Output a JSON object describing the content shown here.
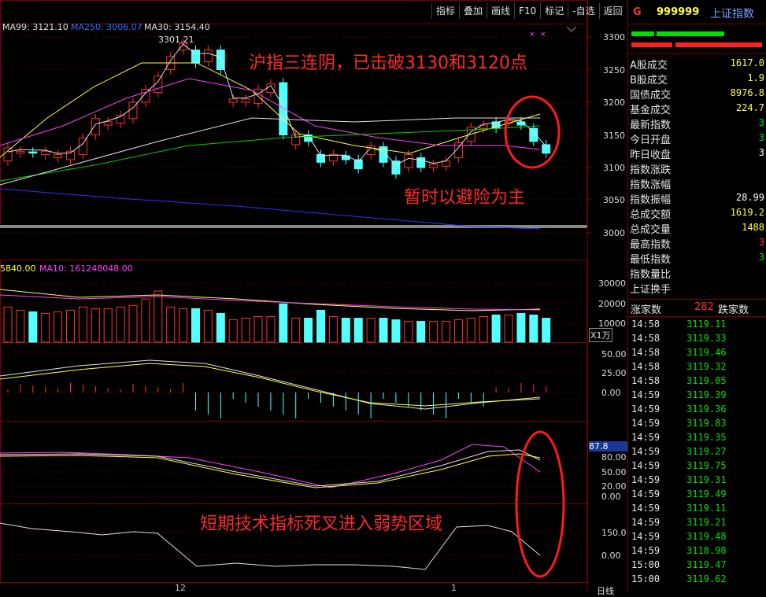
{
  "toolbar": {
    "items": [
      "指标",
      "叠加",
      "画线",
      "F10",
      "标记",
      "-自选",
      "返回"
    ]
  },
  "header": {
    "ma99_label": "MA99: 3121.10",
    "ma250_label": "MA250: 3006.07",
    "ma30_label": "MA30: 3154.40",
    "high_marker": "3301.21",
    "vol_label": "5840.00",
    "vol_ma10_label": "MA10: 161248048.00",
    "vol_unit": "X1万",
    "day_marker": "12",
    "day_marker2": "1",
    "bottom_tab": "日线"
  },
  "price_axis": [
    "3300",
    "3250",
    "3200",
    "3150",
    "3100",
    "3050",
    "3000"
  ],
  "vol_axis": [
    "30000",
    "20000",
    "10000"
  ],
  "macd_axis": [
    "50.00",
    "25.00",
    "0.00"
  ],
  "kdj_axis": [
    "87.8",
    "80.00",
    "50.00",
    "20.00",
    "0.00"
  ],
  "cci_axis": [
    "150.0",
    "0.00"
  ],
  "annotations": {
    "top": "沪指三连阴，已击破3130和3120点",
    "mid": "暂时以避险为主",
    "bottom": "短期技术指标死叉进入弱势区域"
  },
  "right_panel": {
    "code_prefix": "G",
    "code": "999999",
    "name": "上证指数",
    "rows": [
      {
        "label": "A股成交",
        "value": "1617.0"
      },
      {
        "label": "B股成交",
        "value": "1.9"
      },
      {
        "label": "国债成交",
        "value": "8976.8"
      },
      {
        "label": "基金成交",
        "value": "224.7"
      },
      {
        "label": "最新指数",
        "value": "3"
      },
      {
        "label": "今日开盘",
        "value": "3"
      },
      {
        "label": "昨日收盘",
        "value": "3"
      },
      {
        "label": "指数涨跌",
        "value": ""
      },
      {
        "label": "指数涨幅",
        "value": ""
      },
      {
        "label": "指数振幅",
        "value": "28.99"
      },
      {
        "label": "总成交额",
        "value": "1619.2"
      },
      {
        "label": "总成交量",
        "value": "1488"
      },
      {
        "label": "最高指数",
        "value": "3"
      },
      {
        "label": "最低指数",
        "value": "3"
      },
      {
        "label": "指数量比",
        "value": ""
      },
      {
        "label": "上证换手",
        "value": ""
      }
    ],
    "up_label": "涨家数",
    "up_count": "282",
    "down_label": "跌家数",
    "ticks": [
      {
        "time": "14:58",
        "price": "3119.11"
      },
      {
        "time": "14:58",
        "price": "3119.33"
      },
      {
        "time": "14:58",
        "price": "3119.46"
      },
      {
        "time": "14:58",
        "price": "3119.32"
      },
      {
        "time": "14:58",
        "price": "3119.05"
      },
      {
        "time": "14:59",
        "price": "3119.39"
      },
      {
        "time": "14:59",
        "price": "3119.36"
      },
      {
        "time": "14:59",
        "price": "3119.83"
      },
      {
        "time": "14:59",
        "price": "3119.35"
      },
      {
        "time": "14:59",
        "price": "3119.27"
      },
      {
        "time": "14:59",
        "price": "3119.75"
      },
      {
        "time": "14:59",
        "price": "3119.31"
      },
      {
        "time": "14:59",
        "price": "3119.49"
      },
      {
        "time": "14:59",
        "price": "3119.11"
      },
      {
        "time": "14:59",
        "price": "3119.21"
      },
      {
        "time": "14:59",
        "price": "3119.48"
      },
      {
        "time": "14:59",
        "price": "3118.98"
      },
      {
        "time": "15:00",
        "price": "3119.47"
      },
      {
        "time": "15:00",
        "price": "3119.62"
      }
    ]
  },
  "colors": {
    "up": "#ff3232",
    "down": "#54ffff",
    "grid": "#7a0000",
    "ma_white": "#e0e0e0",
    "ma_yellow": "#ffff40",
    "ma_magenta": "#ff40ff",
    "ma_green": "#00d000",
    "ma_blue": "#3030ff",
    "annotation": "#ff2a2a"
  },
  "chart_data": {
    "type": "candlestick",
    "yrange": [
      3000,
      3300
    ],
    "candles": [
      {
        "o": 3110,
        "c": 3130
      },
      {
        "o": 3122,
        "c": 3125
      },
      {
        "o": 3124,
        "c": 3122
      },
      {
        "o": 3120,
        "c": 3125
      },
      {
        "o": 3115,
        "c": 3120
      },
      {
        "o": 3112,
        "c": 3125
      },
      {
        "o": 3120,
        "c": 3145
      },
      {
        "o": 3150,
        "c": 3175
      },
      {
        "o": 3165,
        "c": 3170
      },
      {
        "o": 3168,
        "c": 3180
      },
      {
        "o": 3175,
        "c": 3200
      },
      {
        "o": 3200,
        "c": 3220
      },
      {
        "o": 3215,
        "c": 3240
      },
      {
        "o": 3250,
        "c": 3270
      },
      {
        "o": 3280,
        "c": 3290
      },
      {
        "o": 3280,
        "c": 3260
      },
      {
        "o": 3262,
        "c": 3280
      },
      {
        "o": 3280,
        "c": 3250
      },
      {
        "o": 3200,
        "c": 3205
      },
      {
        "o": 3200,
        "c": 3205
      },
      {
        "o": 3198,
        "c": 3220
      },
      {
        "o": 3215,
        "c": 3228
      },
      {
        "o": 3230,
        "c": 3150
      },
      {
        "o": 3135,
        "c": 3150
      },
      {
        "o": 3150,
        "c": 3140
      },
      {
        "o": 3120,
        "c": 3108
      },
      {
        "o": 3110,
        "c": 3120
      },
      {
        "o": 3118,
        "c": 3112
      },
      {
        "o": 3112,
        "c": 3098
      },
      {
        "o": 3120,
        "c": 3133
      },
      {
        "o": 3132,
        "c": 3108
      },
      {
        "o": 3110,
        "c": 3090
      },
      {
        "o": 3100,
        "c": 3120
      },
      {
        "o": 3115,
        "c": 3100
      },
      {
        "o": 3100,
        "c": 3105
      },
      {
        "o": 3102,
        "c": 3110
      },
      {
        "o": 3115,
        "c": 3138
      },
      {
        "o": 3140,
        "c": 3162
      },
      {
        "o": 3160,
        "c": 3165
      },
      {
        "o": 3170,
        "c": 3160
      },
      {
        "o": 3168,
        "c": 3172
      },
      {
        "o": 3170,
        "c": 3165
      },
      {
        "o": 3160,
        "c": 3140
      },
      {
        "o": 3135,
        "c": 3122
      }
    ],
    "volume": [
      22000,
      20000,
      19000,
      18000,
      19000,
      20000,
      22000,
      21000,
      21000,
      22000,
      23000,
      27000,
      32000,
      22000,
      21000,
      21000,
      20000,
      18000,
      14000,
      15000,
      16000,
      16000,
      24000,
      15000,
      15000,
      20000,
      16000,
      15000,
      15000,
      15000,
      15000,
      14000,
      13000,
      13000,
      13000,
      13000,
      14000,
      15000,
      16000,
      17000,
      17000,
      18000,
      17000,
      15000
    ]
  }
}
